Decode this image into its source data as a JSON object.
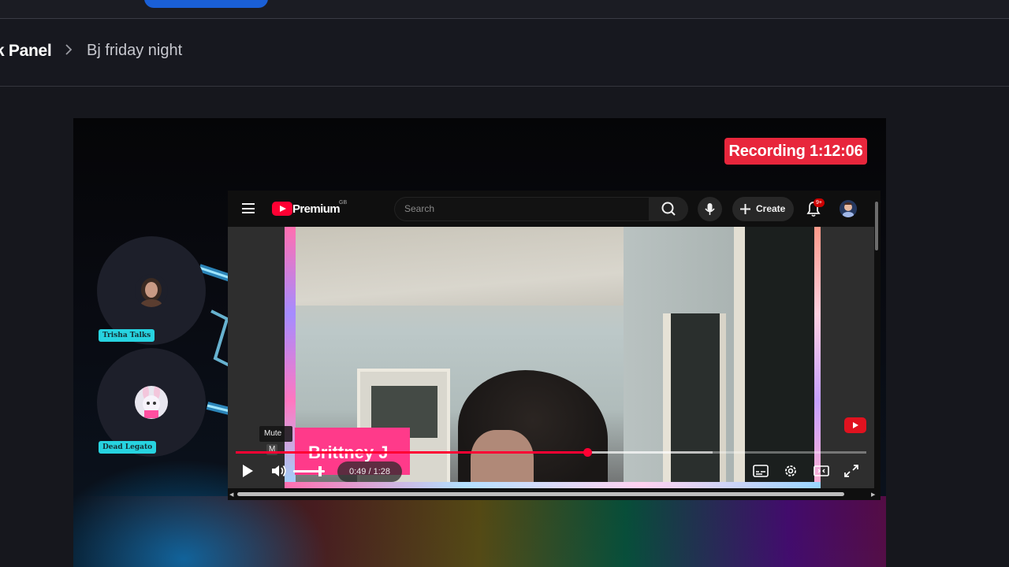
{
  "breadcrumb": {
    "panel_label": "k Panel",
    "separator": ">",
    "page_label": "Bj friday night"
  },
  "recording": {
    "label": "Recording 1:12:06",
    "color": "#e8263c"
  },
  "participants": [
    {
      "name": "Trisha Talks",
      "avatar_icon": "woman-avatar"
    },
    {
      "name": "Dead Legato",
      "avatar_icon": "bunny-avatar"
    }
  ],
  "youtube": {
    "brand": "Premium",
    "region": "GB",
    "search_placeholder": "Search",
    "create_label": "Create",
    "notification_badge": "9+",
    "video": {
      "lower_third_name": "Brittney J",
      "time": "0:49 / 1:28",
      "progress_fraction": 0.557,
      "tooltip_label": "Mute",
      "tooltip_key": "M"
    }
  },
  "colors": {
    "accent": "#1a5fd6",
    "youtube_red": "#ff0033",
    "name_tag": "#27d3e0",
    "lower_third": "#ff3a8a"
  }
}
